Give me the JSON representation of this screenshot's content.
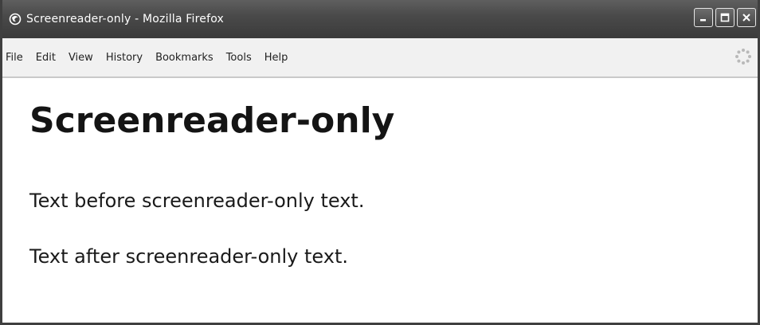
{
  "window": {
    "title": "Screenreader-only - Mozilla Firefox"
  },
  "menu": {
    "items": [
      "File",
      "Edit",
      "View",
      "History",
      "Bookmarks",
      "Tools",
      "Help"
    ]
  },
  "page": {
    "heading": "Screenreader-only",
    "paragraphs": [
      "Text before screenreader-only text.",
      "Text after screenreader-only text."
    ]
  },
  "icons": {
    "app": "firefox-icon",
    "minimize": "minimize-icon",
    "maximize": "maximize-icon",
    "close": "close-icon",
    "throbber": "loading-throbber-icon"
  }
}
